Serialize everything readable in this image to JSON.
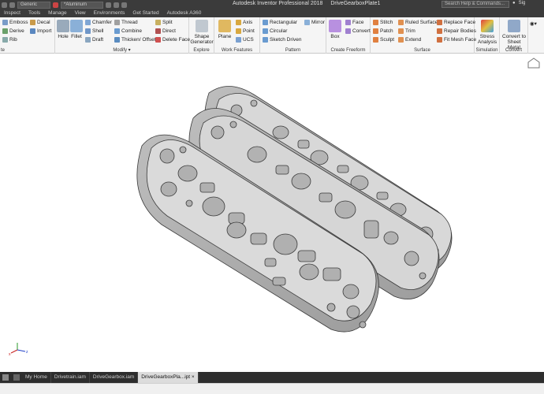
{
  "title_bar": {
    "app_title": "Autodesk Inventor Professional 2018",
    "document_title": "DriveGearboxPlate1",
    "appearance": "Generic",
    "material": "*Aluminum",
    "search_placeholder": "Search Help & Commands...",
    "user": "Sig"
  },
  "menu": [
    "Inspect",
    "Tools",
    "Manage",
    "View",
    "Environments",
    "Get Started",
    "Autodesk A360"
  ],
  "ribbon": {
    "create_partial": {
      "items": [
        "Emboss",
        "Derive",
        "Rib"
      ],
      "items2": [
        "Decal",
        "Import"
      ],
      "title": "te"
    },
    "modify": {
      "title": "Modify",
      "hole": "Hole",
      "fillet": "Fillet",
      "col1": [
        "Chamfer",
        "Shell",
        "Draft"
      ],
      "col2": [
        "Thread",
        "Combine",
        "Thicken/ Offset"
      ],
      "col3": [
        "Split",
        "Direct",
        "Delete Face"
      ]
    },
    "explore": {
      "title": "Explore",
      "shape_generator": "Shape Generator"
    },
    "work_features": {
      "title": "Work Features",
      "plane": "Plane",
      "items": [
        "Axis",
        "Point",
        "UCS"
      ]
    },
    "pattern": {
      "title": "Pattern",
      "items": [
        "Rectangular",
        "Circular",
        "Sketch Driven"
      ],
      "mirror": "Mirror"
    },
    "create_freeform": {
      "title": "Create Freeform",
      "box": "Box",
      "items": [
        "Face",
        "Convert"
      ]
    },
    "surface": {
      "title": "Surface",
      "col1": [
        "Stitch",
        "Patch",
        "Sculpt"
      ],
      "col2": [
        "Ruled Surface",
        "Trim",
        "Extend"
      ],
      "col3": [
        "Replace Face",
        "Repair Bodies",
        "Fit Mesh Face"
      ]
    },
    "simulation": {
      "title": "Simulation",
      "stress": "Stress Analysis"
    },
    "convert": {
      "title": "Convert",
      "sheet_metal": "Convert to Sheet Metal"
    }
  },
  "bottom_tabs": {
    "home": "My Home",
    "tabs": [
      "Drivetrain.iam",
      "DriveGearbox.iam",
      "DriveGearboxPla...ipt"
    ],
    "active_index": 2
  },
  "colors": {
    "titlebar": "#3b3b3b",
    "ribbon": "#f5f5f5",
    "part": "#d4d4d4",
    "part_edge": "#3a3a3a"
  }
}
